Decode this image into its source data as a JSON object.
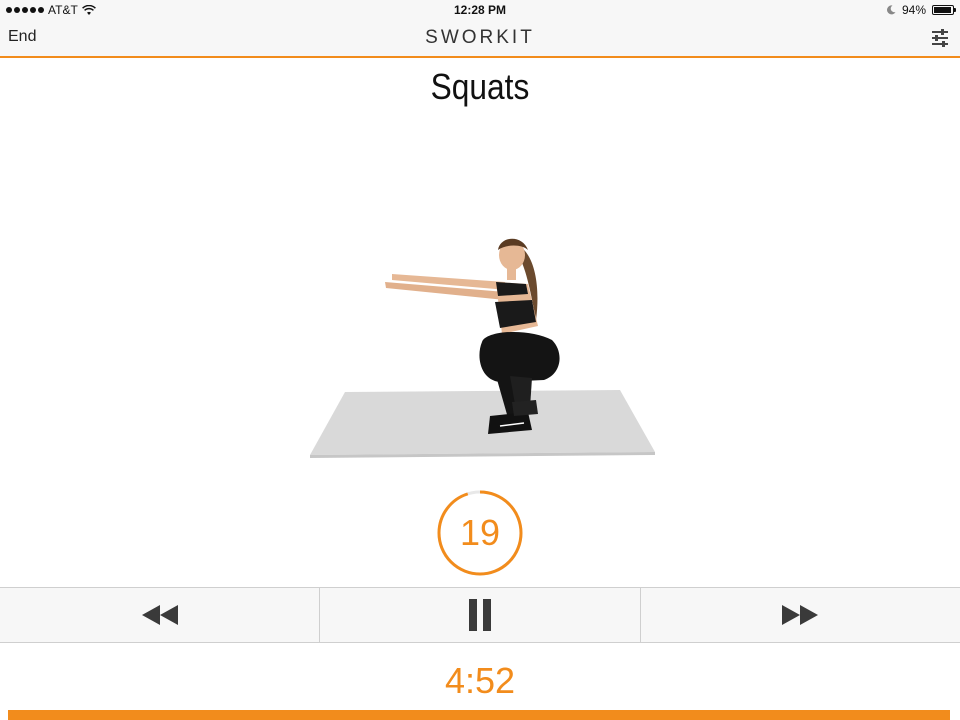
{
  "status_bar": {
    "carrier": "AT&T",
    "time": "12:28 PM",
    "battery": "94%",
    "battery_level": 0.94
  },
  "nav": {
    "end_label": "End",
    "logo": "SWORKIT",
    "settings_icon": "sliders-icon"
  },
  "exercise": {
    "name": "Squats"
  },
  "rest_timer": {
    "value": "19",
    "progress": 0.95
  },
  "controls": {
    "previous_icon": "rewind-icon",
    "pause_icon": "pause-icon",
    "next_icon": "fast-forward-icon"
  },
  "total_timer": {
    "value": "4:52"
  },
  "workout_progress": {
    "fraction": 0.99
  },
  "colors": {
    "accent": "#f28c1c"
  }
}
